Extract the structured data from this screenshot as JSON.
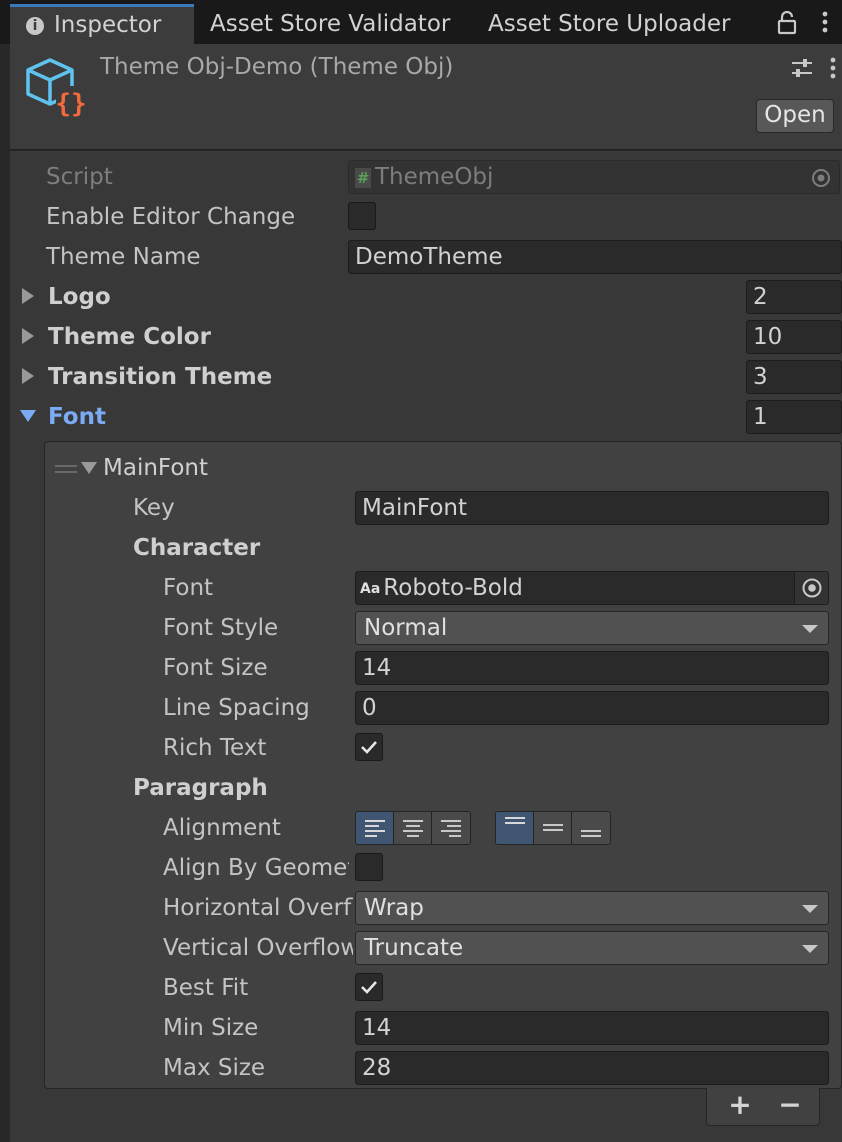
{
  "tabs": [
    {
      "label": "Inspector",
      "active": true
    },
    {
      "label": "Asset Store Validator",
      "active": false
    },
    {
      "label": "Asset Store Uploader",
      "active": false
    }
  ],
  "header": {
    "title": "Theme Obj-Demo (Theme Obj)",
    "open_label": "Open",
    "icon": "scriptable-object-icon"
  },
  "fields": {
    "script": {
      "label": "Script",
      "value": "ThemeObj"
    },
    "enable_editor_change": {
      "label": "Enable Editor Change",
      "checked": false
    },
    "theme_name": {
      "label": "Theme Name",
      "value": "DemoTheme"
    },
    "logo": {
      "label": "Logo",
      "count": "2"
    },
    "theme_color": {
      "label": "Theme Color",
      "count": "10"
    },
    "transition_theme": {
      "label": "Transition Theme",
      "count": "3"
    },
    "font": {
      "label": "Font",
      "count": "1"
    }
  },
  "font_item": {
    "name": "MainFont",
    "key": {
      "label": "Key",
      "value": "MainFont"
    },
    "character": {
      "header": "Character",
      "font": {
        "label": "Font",
        "value": "Roboto-Bold",
        "icon_text": "Aa"
      },
      "font_style": {
        "label": "Font Style",
        "value": "Normal"
      },
      "font_size": {
        "label": "Font Size",
        "value": "14"
      },
      "line_spacing": {
        "label": "Line Spacing",
        "value": "0"
      },
      "rich_text": {
        "label": "Rich Text",
        "checked": true
      }
    },
    "paragraph": {
      "header": "Paragraph",
      "alignment": {
        "label": "Alignment",
        "horizontal_selected": "left",
        "vertical_selected": "top"
      },
      "align_by_geometry": {
        "label": "Align By Geomet",
        "checked": false
      },
      "horizontal_overflow": {
        "label": "Horizontal Overfl",
        "value": "Wrap"
      },
      "vertical_overflow": {
        "label": "Vertical Overflow",
        "value": "Truncate"
      },
      "best_fit": {
        "label": "Best Fit",
        "checked": true
      },
      "min_size": {
        "label": "Min Size",
        "value": "14"
      },
      "max_size": {
        "label": "Max Size",
        "value": "28"
      }
    }
  },
  "list_controls": {
    "add": "+",
    "remove": "−"
  },
  "colors": {
    "accent": "#3a79bb",
    "foldout_active": "#7babf5",
    "icon_blue": "#5fc3ef",
    "icon_orange": "#f26a3d"
  }
}
